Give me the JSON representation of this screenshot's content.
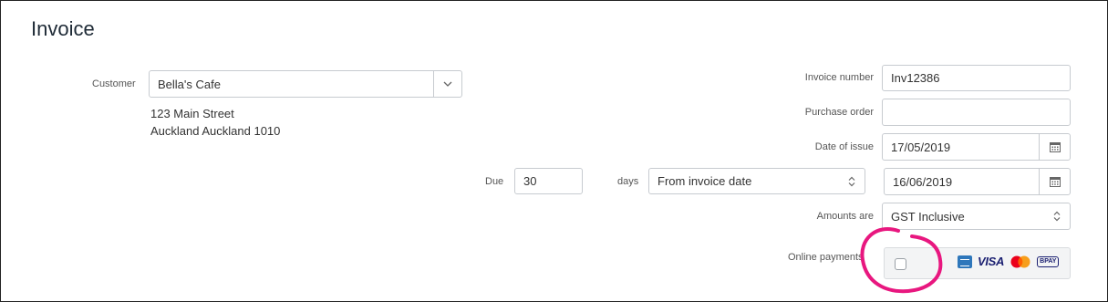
{
  "page": {
    "title": "Invoice"
  },
  "customer": {
    "label": "Customer",
    "value": "Bella's Cafe",
    "address_line1": "123 Main Street",
    "address_line2": "Auckland Auckland 1010"
  },
  "invoice_number": {
    "label": "Invoice number",
    "value": "Inv12386"
  },
  "purchase_order": {
    "label": "Purchase order",
    "value": ""
  },
  "date_of_issue": {
    "label": "Date of issue",
    "value": "17/05/2019"
  },
  "due": {
    "label": "Due",
    "value": "30",
    "days_label": "days",
    "terms": "From invoice date",
    "date": "16/06/2019"
  },
  "amounts_are": {
    "label": "Amounts are",
    "value": "GST Inclusive"
  },
  "online_payments": {
    "label": "Online payments",
    "checked": false,
    "logos": [
      "amex-icon",
      "visa-icon",
      "mastercard-icon",
      "bpay-icon"
    ],
    "visa_text": "VISA",
    "bpay_text": "BPAY"
  },
  "colors": {
    "highlight": "#e8177f",
    "border": "#c7cbd0",
    "visa": "#1a1f71"
  }
}
